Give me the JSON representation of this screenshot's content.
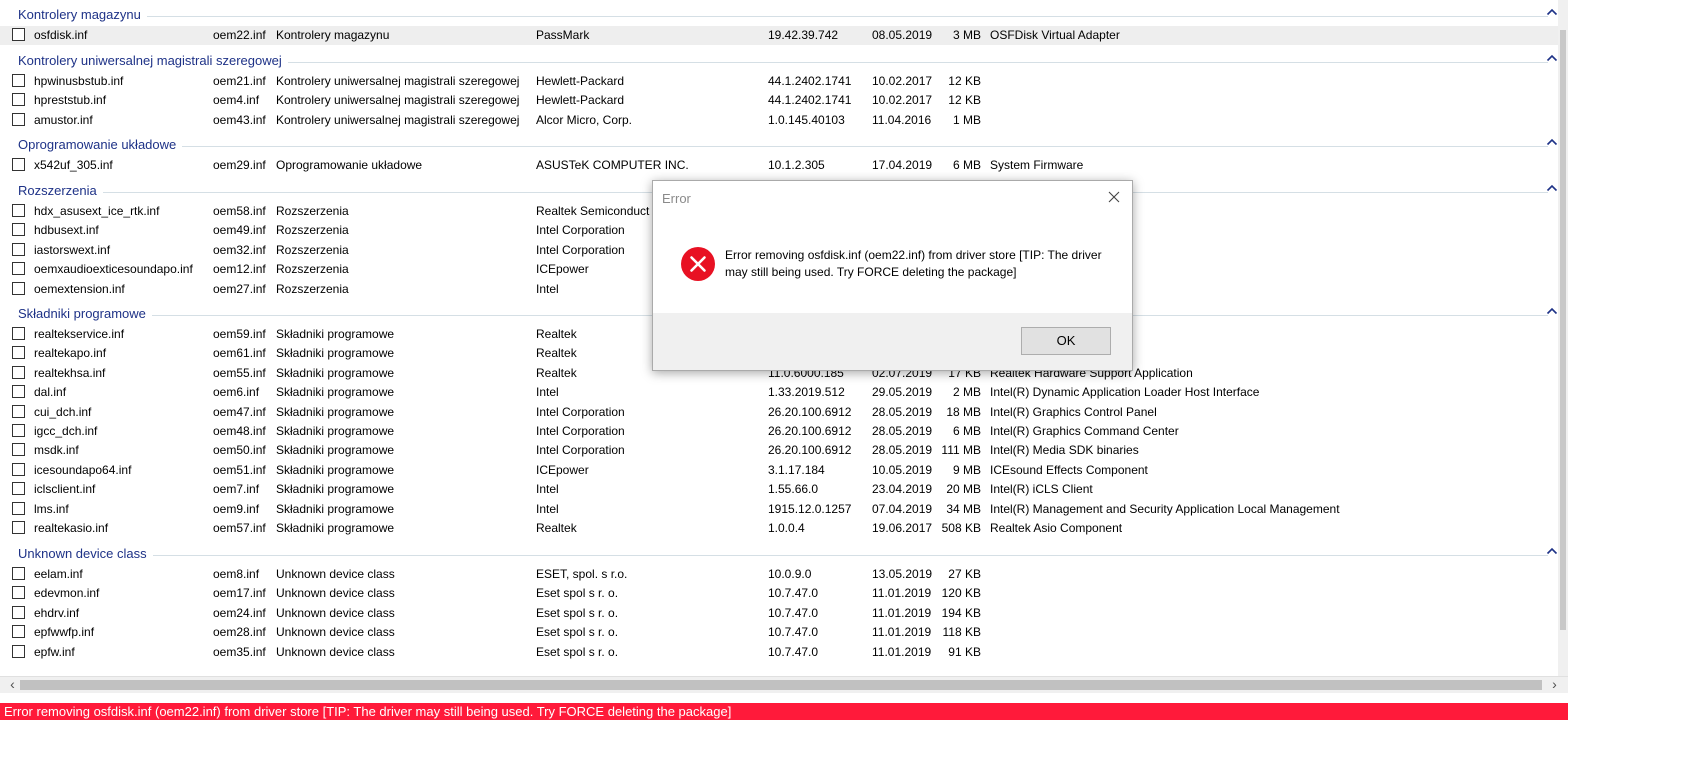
{
  "groups": [
    {
      "title": "Kontrolery magazynu",
      "rows": [
        {
          "name": "osfdisk.inf",
          "oem": "oem22.inf",
          "class": "Kontrolery magazynu",
          "provider": "PassMark",
          "version": "19.42.39.742",
          "date": "08.05.2019",
          "size": "3 MB",
          "desc": "OSFDisk Virtual Adapter"
        }
      ]
    },
    {
      "title": "Kontrolery uniwersalnej magistrali szeregowej",
      "rows": [
        {
          "name": "hpwinusbstub.inf",
          "oem": "oem21.inf",
          "class": "Kontrolery uniwersalnej magistrali szeregowej",
          "provider": "Hewlett-Packard",
          "version": "44.1.2402.1741",
          "date": "10.02.2017",
          "size": "12 KB",
          "desc": ""
        },
        {
          "name": "hpreststub.inf",
          "oem": "oem4.inf",
          "class": "Kontrolery uniwersalnej magistrali szeregowej",
          "provider": "Hewlett-Packard",
          "version": "44.1.2402.1741",
          "date": "10.02.2017",
          "size": "12 KB",
          "desc": ""
        },
        {
          "name": "amustor.inf",
          "oem": "oem43.inf",
          "class": "Kontrolery uniwersalnej magistrali szeregowej",
          "provider": "Alcor Micro, Corp.",
          "version": "1.0.145.40103",
          "date": "11.04.2016",
          "size": "1 MB",
          "desc": ""
        }
      ]
    },
    {
      "title": "Oprogramowanie układowe",
      "rows": [
        {
          "name": "x542uf_305.inf",
          "oem": "oem29.inf",
          "class": "Oprogramowanie układowe",
          "provider": "ASUSTeK COMPUTER INC.",
          "version": "10.1.2.305",
          "date": "17.04.2019",
          "size": "6 MB",
          "desc": "System Firmware"
        }
      ]
    },
    {
      "title": "Rozszerzenia",
      "rows": [
        {
          "name": "hdx_asusext_ice_rtk.inf",
          "oem": "oem58.inf",
          "class": "Rozszerzenia",
          "provider": "Realtek Semiconduct",
          "version": "",
          "date": "",
          "size": "",
          "desc": ""
        },
        {
          "name": "hdbusext.inf",
          "oem": "oem49.inf",
          "class": "Rozszerzenia",
          "provider": "Intel Corporation",
          "version": "",
          "date": "",
          "size": "",
          "desc": ""
        },
        {
          "name": "iastorswext.inf",
          "oem": "oem32.inf",
          "class": "Rozszerzenia",
          "provider": "Intel Corporation",
          "version": "",
          "date": "",
          "size": "",
          "desc": ""
        },
        {
          "name": "oemxaudioexticesoundapo.inf",
          "oem": "oem12.inf",
          "class": "Rozszerzenia",
          "provider": "ICEpower",
          "version": "",
          "date": "",
          "size": "",
          "desc": ""
        },
        {
          "name": "oemextension.inf",
          "oem": "oem27.inf",
          "class": "Rozszerzenia",
          "provider": "Intel",
          "version": "",
          "date": "",
          "size": "",
          "desc": ""
        }
      ]
    },
    {
      "title": "Składniki programowe",
      "rows": [
        {
          "name": "realtekservice.inf",
          "oem": "oem59.inf",
          "class": "Składniki programowe",
          "provider": "Realtek",
          "version": "",
          "date": "",
          "size": "",
          "desc": "ervice"
        },
        {
          "name": "realtekapo.inf",
          "oem": "oem61.inf",
          "class": "Składniki programowe",
          "provider": "Realtek",
          "version": "",
          "date": "",
          "size": "",
          "desc": "ponent"
        },
        {
          "name": "realtekhsa.inf",
          "oem": "oem55.inf",
          "class": "Składniki programowe",
          "provider": "Realtek",
          "version": "11.0.6000.185",
          "date": "02.07.2019",
          "size": "17 KB",
          "desc": "Realtek Hardware Support Application"
        },
        {
          "name": "dal.inf",
          "oem": "oem6.inf",
          "class": "Składniki programowe",
          "provider": "Intel",
          "version": "1.33.2019.512",
          "date": "29.05.2019",
          "size": "2 MB",
          "desc": "Intel(R) Dynamic Application Loader Host Interface"
        },
        {
          "name": "cui_dch.inf",
          "oem": "oem47.inf",
          "class": "Składniki programowe",
          "provider": "Intel Corporation",
          "version": "26.20.100.6912",
          "date": "28.05.2019",
          "size": "18 MB",
          "desc": "Intel(R) Graphics Control Panel"
        },
        {
          "name": "igcc_dch.inf",
          "oem": "oem48.inf",
          "class": "Składniki programowe",
          "provider": "Intel Corporation",
          "version": "26.20.100.6912",
          "date": "28.05.2019",
          "size": "6 MB",
          "desc": "Intel(R) Graphics Command Center"
        },
        {
          "name": "msdk.inf",
          "oem": "oem50.inf",
          "class": "Składniki programowe",
          "provider": "Intel Corporation",
          "version": "26.20.100.6912",
          "date": "28.05.2019",
          "size": "111 MB",
          "desc": "Intel(R) Media SDK binaries"
        },
        {
          "name": "icesoundapo64.inf",
          "oem": "oem51.inf",
          "class": "Składniki programowe",
          "provider": "ICEpower",
          "version": "3.1.17.184",
          "date": "10.05.2019",
          "size": "9 MB",
          "desc": "ICEsound Effects Component"
        },
        {
          "name": "iclsclient.inf",
          "oem": "oem7.inf",
          "class": "Składniki programowe",
          "provider": "Intel",
          "version": "1.55.66.0",
          "date": "23.04.2019",
          "size": "20 MB",
          "desc": "Intel(R) iCLS Client"
        },
        {
          "name": "lms.inf",
          "oem": "oem9.inf",
          "class": "Składniki programowe",
          "provider": "Intel",
          "version": "1915.12.0.1257",
          "date": "07.04.2019",
          "size": "34 MB",
          "desc": "Intel(R) Management and Security Application Local Management"
        },
        {
          "name": "realtekasio.inf",
          "oem": "oem57.inf",
          "class": "Składniki programowe",
          "provider": "Realtek",
          "version": "1.0.0.4",
          "date": "19.06.2017",
          "size": "508 KB",
          "desc": "Realtek Asio Component"
        }
      ]
    },
    {
      "title": "Unknown device class",
      "rows": [
        {
          "name": "eelam.inf",
          "oem": "oem8.inf",
          "class": "Unknown device class",
          "provider": "ESET, spol. s r.o.",
          "version": "10.0.9.0",
          "date": "13.05.2019",
          "size": "27 KB",
          "desc": ""
        },
        {
          "name": "edevmon.inf",
          "oem": "oem17.inf",
          "class": "Unknown device class",
          "provider": "Eset spol s r. o.",
          "version": "10.7.47.0",
          "date": "11.01.2019",
          "size": "120 KB",
          "desc": ""
        },
        {
          "name": "ehdrv.inf",
          "oem": "oem24.inf",
          "class": "Unknown device class",
          "provider": "Eset spol s r. o.",
          "version": "10.7.47.0",
          "date": "11.01.2019",
          "size": "194 KB",
          "desc": ""
        },
        {
          "name": "epfwwfp.inf",
          "oem": "oem28.inf",
          "class": "Unknown device class",
          "provider": "Eset spol s r. o.",
          "version": "10.7.47.0",
          "date": "11.01.2019",
          "size": "118 KB",
          "desc": ""
        },
        {
          "name": "epfw.inf",
          "oem": "oem35.inf",
          "class": "Unknown device class",
          "provider": "Eset spol s r. o.",
          "version": "10.7.47.0",
          "date": "11.01.2019",
          "size": "91 KB",
          "desc": ""
        }
      ]
    }
  ],
  "dialog": {
    "title": "Error",
    "message": "Error removing osfdisk.inf (oem22.inf) from driver store  [TIP: The driver may still being used. Try FORCE deleting the package]",
    "ok_label": "OK"
  },
  "statusbar": {
    "text": "Error removing osfdisk.inf (oem22.inf) from driver store  [TIP: The driver may still being used. Try FORCE deleting the package]"
  },
  "colors": {
    "group_header": "#1e3287",
    "statusbar_bg": "#ff1a3a",
    "error_icon": "#e81123"
  },
  "icons": {
    "group_collapse": "chevron-up-icon",
    "dialog_close": "close-icon",
    "dialog_error": "error-icon"
  }
}
